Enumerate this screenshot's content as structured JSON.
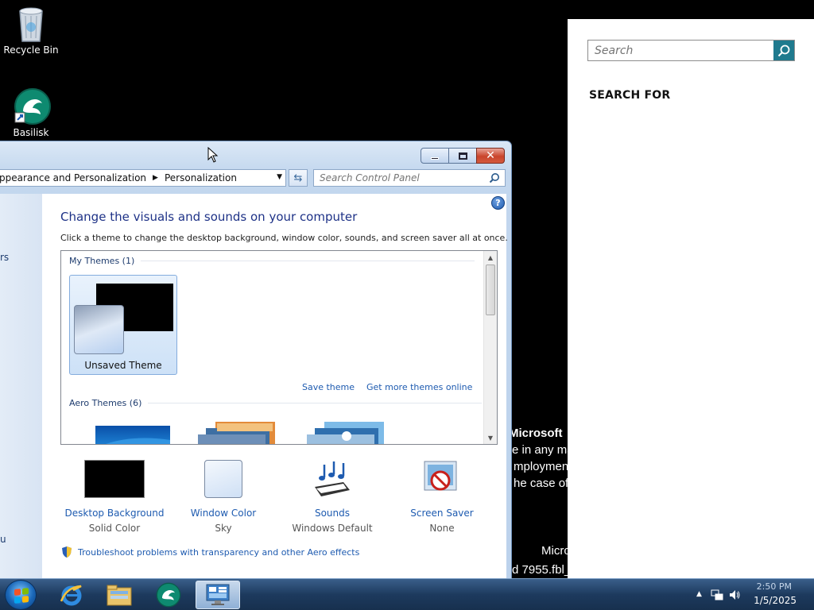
{
  "desktop": {
    "icons": [
      {
        "label": "Recycle Bin",
        "icon": "recycle-bin-icon"
      },
      {
        "label": "Basilisk",
        "icon": "basilisk-icon"
      }
    ],
    "background_text": [
      "Microsoft",
      "e in any ma",
      "mploymen",
      "he case of",
      "Micro",
      "d 7955.fbl_"
    ]
  },
  "window": {
    "breadcrumb": [
      "ppearance and Personalization",
      "Personalization"
    ],
    "search_placeholder": "Search Control Panel",
    "side_fragments": [
      "rs",
      "u"
    ],
    "heading": "Change the visuals and sounds on your computer",
    "subheading": "Click a theme to change the desktop background, window color, sounds, and screen saver all at once.",
    "my_themes_header": "My Themes (1)",
    "unsaved_theme_label": "Unsaved Theme",
    "save_theme_link": "Save theme",
    "get_more_link": "Get more themes online",
    "aero_themes_header": "Aero Themes (6)",
    "options": [
      {
        "label": "Desktop Background",
        "value": "Solid Color",
        "icon": "desktop-background-icon"
      },
      {
        "label": "Window Color",
        "value": "Sky",
        "icon": "window-color-icon"
      },
      {
        "label": "Sounds",
        "value": "Windows Default",
        "icon": "sounds-icon"
      },
      {
        "label": "Screen Saver",
        "value": "None",
        "icon": "screen-saver-icon"
      }
    ],
    "troubleshoot_link": "Troubleshoot problems with transparency and other Aero effects"
  },
  "charms": {
    "search_placeholder": "Search",
    "search_for_label": "SEARCH FOR"
  },
  "taskbar": {
    "date": "1/5/2025",
    "time_partial": "2:50 PM",
    "items": [
      "internet-explorer-icon",
      "file-explorer-icon",
      "basilisk-icon",
      "control-panel-icon"
    ]
  },
  "colors": {
    "accent": "#1f7a8e",
    "link": "#1e5bb0",
    "heading": "#1e3287"
  }
}
